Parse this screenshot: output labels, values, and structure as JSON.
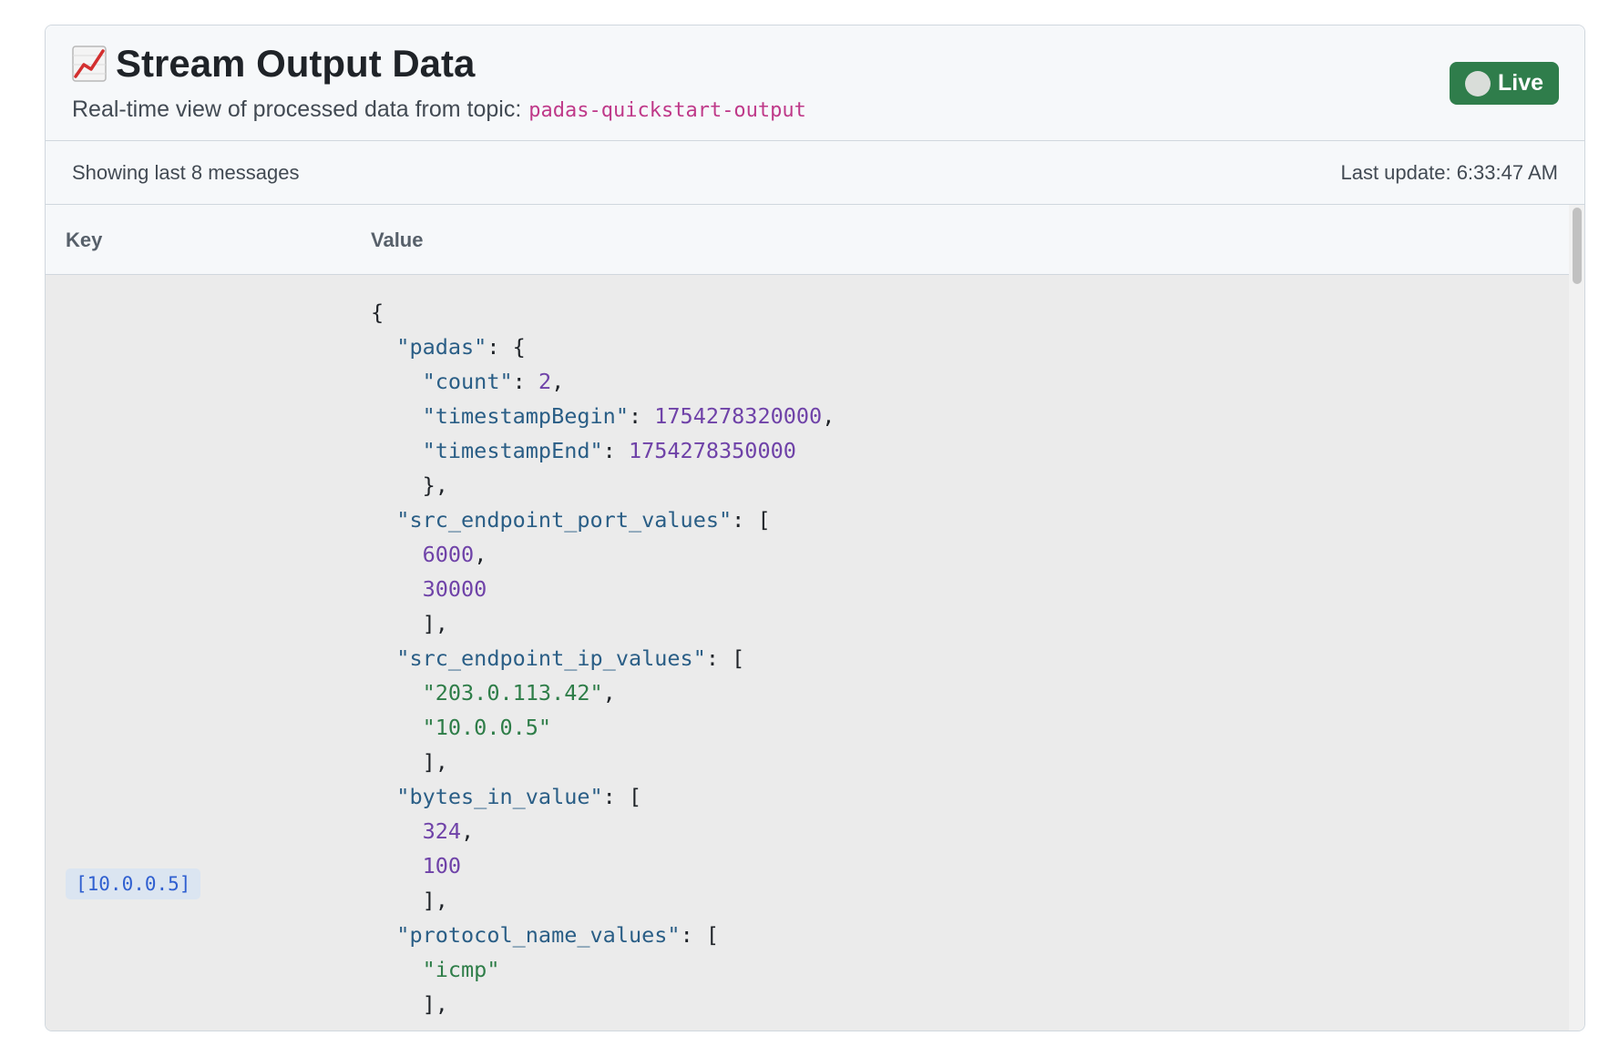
{
  "header": {
    "title": "Stream Output Data",
    "title_icon": "chart-increasing-icon",
    "subtitle_prefix": "Real-time view of processed data from topic:",
    "topic": "padas-quickstart-output",
    "live_label": "Live"
  },
  "info": {
    "showing": "Showing last 8 messages",
    "last_update": "Last update: 6:33:47 AM"
  },
  "table": {
    "columns": {
      "key": "Key",
      "value": "Value"
    },
    "rows": [
      {
        "key": "[10.0.0.5]",
        "value_lines": [
          [
            {
              "t": "p",
              "v": "{"
            }
          ],
          [
            {
              "t": "p",
              "v": "  "
            },
            {
              "t": "k",
              "v": "\"padas\""
            },
            {
              "t": "p",
              "v": ": {"
            }
          ],
          [
            {
              "t": "p",
              "v": "    "
            },
            {
              "t": "k",
              "v": "\"count\""
            },
            {
              "t": "p",
              "v": ": "
            },
            {
              "t": "n",
              "v": "2"
            },
            {
              "t": "p",
              "v": ","
            }
          ],
          [
            {
              "t": "p",
              "v": "    "
            },
            {
              "t": "k",
              "v": "\"timestampBegin\""
            },
            {
              "t": "p",
              "v": ": "
            },
            {
              "t": "n",
              "v": "1754278320000"
            },
            {
              "t": "p",
              "v": ","
            }
          ],
          [
            {
              "t": "p",
              "v": "    "
            },
            {
              "t": "k",
              "v": "\"timestampEnd\""
            },
            {
              "t": "p",
              "v": ": "
            },
            {
              "t": "n",
              "v": "1754278350000"
            }
          ],
          [
            {
              "t": "p",
              "v": "    },"
            }
          ],
          [
            {
              "t": "p",
              "v": "  "
            },
            {
              "t": "k",
              "v": "\"src_endpoint_port_values\""
            },
            {
              "t": "p",
              "v": ": ["
            }
          ],
          [
            {
              "t": "p",
              "v": "    "
            },
            {
              "t": "n",
              "v": "6000"
            },
            {
              "t": "p",
              "v": ","
            }
          ],
          [
            {
              "t": "p",
              "v": "    "
            },
            {
              "t": "n",
              "v": "30000"
            }
          ],
          [
            {
              "t": "p",
              "v": "    ],"
            }
          ],
          [
            {
              "t": "p",
              "v": "  "
            },
            {
              "t": "k",
              "v": "\"src_endpoint_ip_values\""
            },
            {
              "t": "p",
              "v": ": ["
            }
          ],
          [
            {
              "t": "p",
              "v": "    "
            },
            {
              "t": "s",
              "v": "\"203.0.113.42\""
            },
            {
              "t": "p",
              "v": ","
            }
          ],
          [
            {
              "t": "p",
              "v": "    "
            },
            {
              "t": "s",
              "v": "\"10.0.0.5\""
            }
          ],
          [
            {
              "t": "p",
              "v": "    ],"
            }
          ],
          [
            {
              "t": "p",
              "v": "  "
            },
            {
              "t": "k",
              "v": "\"bytes_in_value\""
            },
            {
              "t": "p",
              "v": ": ["
            }
          ],
          [
            {
              "t": "p",
              "v": "    "
            },
            {
              "t": "n",
              "v": "324"
            },
            {
              "t": "p",
              "v": ","
            }
          ],
          [
            {
              "t": "p",
              "v": "    "
            },
            {
              "t": "n",
              "v": "100"
            }
          ],
          [
            {
              "t": "p",
              "v": "    ],"
            }
          ],
          [
            {
              "t": "p",
              "v": "  "
            },
            {
              "t": "k",
              "v": "\"protocol_name_values\""
            },
            {
              "t": "p",
              "v": ": ["
            }
          ],
          [
            {
              "t": "p",
              "v": "    "
            },
            {
              "t": "s",
              "v": "\"icmp\""
            }
          ],
          [
            {
              "t": "p",
              "v": "    ],"
            }
          ]
        ]
      }
    ]
  },
  "colors": {
    "live": "#2f7d4b",
    "topic": "#bf3989",
    "json_key": "#2a5e86",
    "json_number": "#6f42a8",
    "json_string": "#2e7d48",
    "key_badge_text": "#2f5fd0"
  }
}
